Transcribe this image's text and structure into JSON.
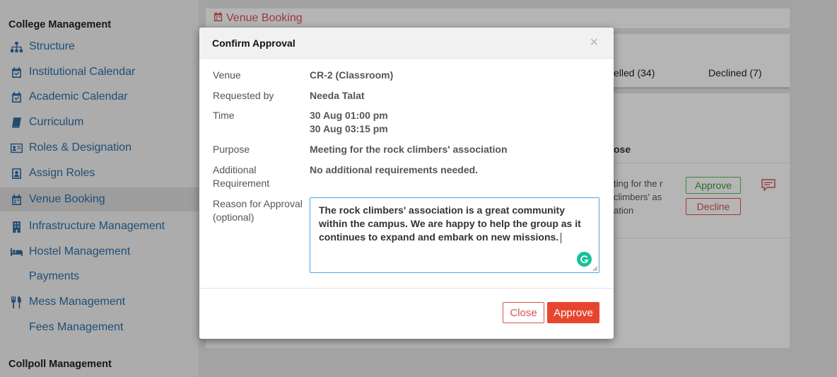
{
  "sidebar": {
    "section1": "College Management",
    "items": [
      {
        "label": "Structure",
        "icon": "sitemap-icon"
      },
      {
        "label": "Institutional Calendar",
        "icon": "calendar-check-icon"
      },
      {
        "label": "Academic Calendar",
        "icon": "calendar-check-icon"
      },
      {
        "label": "Curriculum",
        "icon": "book-icon"
      },
      {
        "label": "Roles & Designation",
        "icon": "id-card-icon"
      },
      {
        "label": "Assign Roles",
        "icon": "user-badge-icon"
      },
      {
        "label": "Venue Booking",
        "icon": "calendar-icon"
      },
      {
        "label": "Infrastructure Management",
        "icon": "building-icon"
      },
      {
        "label": "Hostel Management",
        "icon": "bed-icon"
      },
      {
        "label": "Payments",
        "icon": ""
      },
      {
        "label": "Mess Management",
        "icon": "utensils-icon"
      },
      {
        "label": "Fees Management",
        "icon": ""
      }
    ],
    "section2": "Collpoll Management"
  },
  "background": {
    "page_title": "Venue Booking",
    "tab_cancelled": "elled (34)",
    "tab_declined": "Declined (7)",
    "col_purpose": "ose",
    "row_purpose_lines": [
      "ting for the r",
      "climbers' as",
      "ation"
    ],
    "approve_label": "Approve",
    "decline_label": "Decline"
  },
  "modal": {
    "title": "Confirm Approval",
    "close_symbol": "×",
    "venue_label": "Venue",
    "venue_value": "CR-2 (Classroom)",
    "requested_by_label": "Requested by",
    "requested_by_value": "Needa Talat",
    "time_label": "Time",
    "time_start": "30 Aug 01:00 pm",
    "time_end": "30 Aug 03:15 pm",
    "purpose_label": "Purpose",
    "purpose_value": "Meeting for the rock climbers' association",
    "additional_label_line1": "Additional",
    "additional_label_line2": "Requirement",
    "additional_value": "No additional requirements needed.",
    "reason_label_line1": "Reason for Approval",
    "reason_label_line2": "(optional)",
    "reason_value": "The rock climbers' association is a great community within the campus. We are happy to help the group as it continues to expand and embark on new missions.",
    "close_button": "Close",
    "approve_button": "Approve"
  },
  "colors": {
    "accent_red": "#e8452f",
    "link_blue": "#2c6fa8",
    "approve_green": "#5cb85c",
    "grammarly_green": "#15c39a"
  }
}
